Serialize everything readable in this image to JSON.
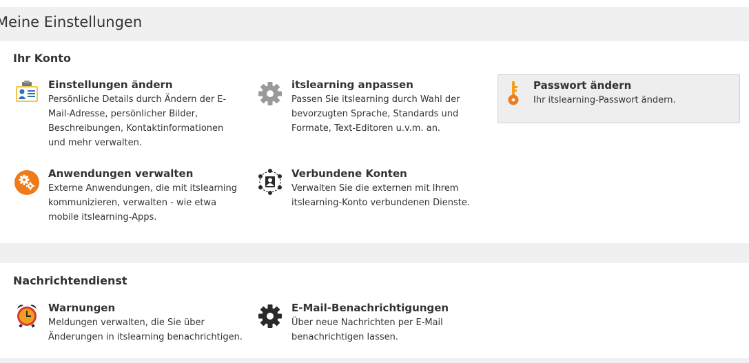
{
  "page": {
    "title": "Meine Einstellungen"
  },
  "sections": {
    "account": {
      "heading": "Ihr Konto"
    },
    "messaging": {
      "heading": "Nachrichtendienst"
    }
  },
  "cards": {
    "settings": {
      "title": "Einstellungen ändern",
      "desc": "Persönliche Details durch Ändern der E-Mail-Adresse, persönlicher Bilder, Beschreibungen, Kontaktinformationen und mehr verwalten.",
      "icon": "id-card-icon"
    },
    "customize": {
      "title": "itslearning anpassen",
      "desc": "Passen Sie itslearning durch Wahl der bevorzugten Sprache, Standards und Formate, Text-Editoren u.v.m. an.",
      "icon": "gear-icon"
    },
    "password": {
      "title": "Passwort ändern",
      "desc": "Ihr itslearning-Passwort ändern.",
      "icon": "key-icon"
    },
    "apps": {
      "title": "Anwendungen verwalten",
      "desc": "Externe Anwendungen, die mit itslearning kommunizieren, verwalten - wie etwa mobile itslearning-Apps.",
      "icon": "app-gears-icon"
    },
    "connected": {
      "title": "Verbundene Konten",
      "desc": "Verwalten Sie die externen mit Ihrem itslearning-Konto verbundenen Dienste.",
      "icon": "network-user-icon"
    },
    "alerts": {
      "title": "Warnungen",
      "desc": "Meldungen verwalten, die Sie über Änderungen in itslearning benachrichtigen.",
      "icon": "alarm-clock-icon"
    },
    "email": {
      "title": "E-Mail-Benachrichtigungen",
      "desc": "Über neue Nachrichten per E-Mail benachrichtigen lassen.",
      "icon": "gear-icon"
    }
  },
  "colors": {
    "band": "#f0f0f0",
    "orange": "#f07a1a",
    "gold": "#f0a020",
    "icon_gray": "#9a9a9a",
    "icon_dark": "#2a2a2a"
  }
}
